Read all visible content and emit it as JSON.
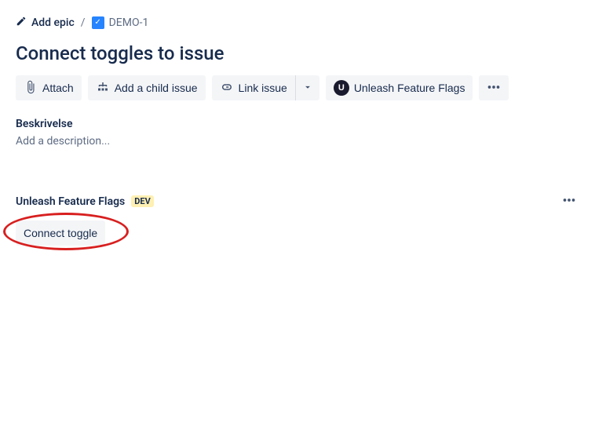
{
  "breadcrumb": {
    "add_epic": "Add epic",
    "separator": "/",
    "issue_key": "DEMO-1"
  },
  "page_title": "Connect toggles to issue",
  "actions": {
    "attach": "Attach",
    "add_child": "Add a child issue",
    "link_issue": "Link issue",
    "unleash": "Unleash Feature Flags",
    "unleash_initial": "U"
  },
  "description": {
    "label": "Beskrivelse",
    "placeholder": "Add a description..."
  },
  "section": {
    "title": "Unleash Feature Flags",
    "badge": "DEV",
    "connect_button": "Connect toggle"
  }
}
